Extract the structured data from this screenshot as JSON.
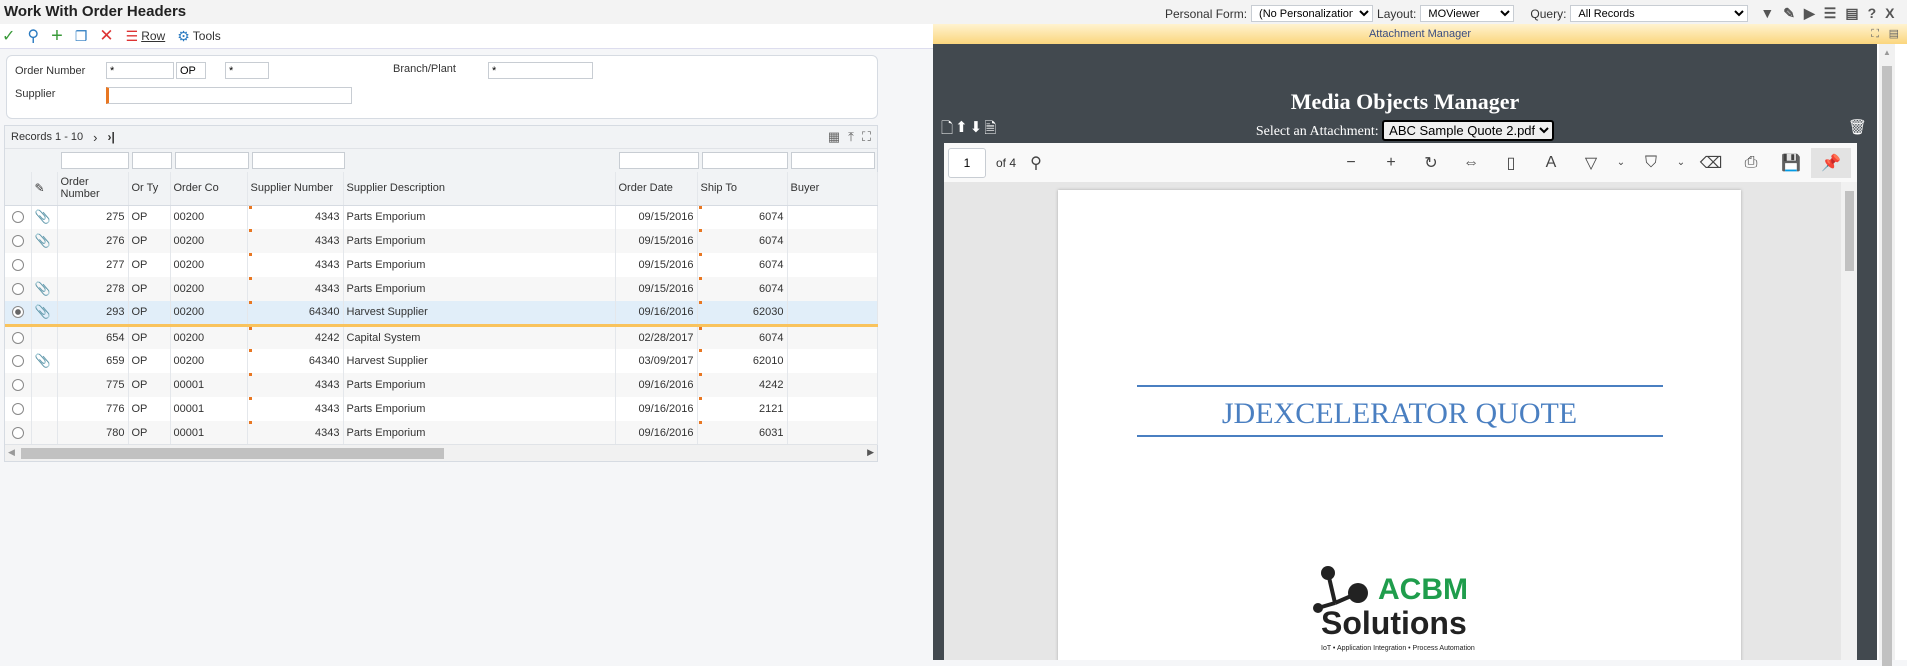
{
  "window": {
    "title": "Work With Order Headers"
  },
  "header": {
    "personal_form_label": "Personal Form:",
    "personal_form_value": "(No Personalization)",
    "layout_label": "Layout:",
    "layout_value": "MOViewer",
    "query_label": "Query:",
    "query_value": "All Records"
  },
  "toolbar": {
    "row_label": "Row",
    "tools_label": "Tools"
  },
  "filters": {
    "order_number_label": "Order Number",
    "order_number": "*",
    "order_type": "OP",
    "order_company": "*",
    "branch_plant_label": "Branch/Plant",
    "branch_plant": "*",
    "supplier_label": "Supplier",
    "supplier": ""
  },
  "grid": {
    "records": "Records 1 - 10",
    "columns": [
      "Order Number",
      "Or Ty",
      "Order Co",
      "Supplier Number",
      "Supplier Description",
      "Order Date",
      "Ship To",
      "Buyer"
    ],
    "rows": [
      {
        "att": true,
        "num": "275",
        "ty": "OP",
        "co": "00200",
        "sup": "4343",
        "desc": "Parts Emporium",
        "date": "09/15/2016",
        "ship": "6074",
        "buyer": ""
      },
      {
        "att": true,
        "num": "276",
        "ty": "OP",
        "co": "00200",
        "sup": "4343",
        "desc": "Parts Emporium",
        "date": "09/15/2016",
        "ship": "6074",
        "buyer": ""
      },
      {
        "att": false,
        "num": "277",
        "ty": "OP",
        "co": "00200",
        "sup": "4343",
        "desc": "Parts Emporium",
        "date": "09/15/2016",
        "ship": "6074",
        "buyer": ""
      },
      {
        "att": true,
        "num": "278",
        "ty": "OP",
        "co": "00200",
        "sup": "4343",
        "desc": "Parts Emporium",
        "date": "09/15/2016",
        "ship": "6074",
        "buyer": ""
      },
      {
        "att": true,
        "num": "293",
        "ty": "OP",
        "co": "00200",
        "sup": "64340",
        "desc": "Harvest Supplier",
        "date": "09/16/2016",
        "ship": "62030",
        "buyer": "",
        "selected": true
      },
      {
        "att": false,
        "num": "654",
        "ty": "OP",
        "co": "00200",
        "sup": "4242",
        "desc": "Capital System",
        "date": "02/28/2017",
        "ship": "6074",
        "buyer": ""
      },
      {
        "att": true,
        "num": "659",
        "ty": "OP",
        "co": "00200",
        "sup": "64340",
        "desc": "Harvest Supplier",
        "date": "03/09/2017",
        "ship": "62010",
        "buyer": ""
      },
      {
        "att": false,
        "num": "775",
        "ty": "OP",
        "co": "00001",
        "sup": "4343",
        "desc": "Parts Emporium",
        "date": "09/16/2016",
        "ship": "4242",
        "buyer": ""
      },
      {
        "att": false,
        "num": "776",
        "ty": "OP",
        "co": "00001",
        "sup": "4343",
        "desc": "Parts Emporium",
        "date": "09/16/2016",
        "ship": "2121",
        "buyer": ""
      },
      {
        "att": false,
        "num": "780",
        "ty": "OP",
        "co": "00001",
        "sup": "4343",
        "desc": "Parts Emporium",
        "date": "09/16/2016",
        "ship": "6031",
        "buyer": ""
      }
    ]
  },
  "attachment": {
    "panel_title": "Attachment Manager",
    "heading": "Media Objects Manager",
    "select_label": "Select an Attachment:",
    "selected_file": "ABC Sample Quote 2.pdf"
  },
  "pdf": {
    "page": "1",
    "of_pages": "of 4",
    "doc_title": "JDEXCELERATOR QUOTE",
    "logo_top": "ACBM",
    "logo_bottom": "Solutions",
    "logo_tagline": "IoT • Application Integration • Process Automation"
  },
  "colors": {
    "accent": "#e87722",
    "selected_row": "#e1eef9",
    "selected_border": "#f9c35d",
    "dark_panel": "#42494f",
    "pdf_title": "#4a7fc1",
    "logo_green": "#1f9d4c"
  }
}
